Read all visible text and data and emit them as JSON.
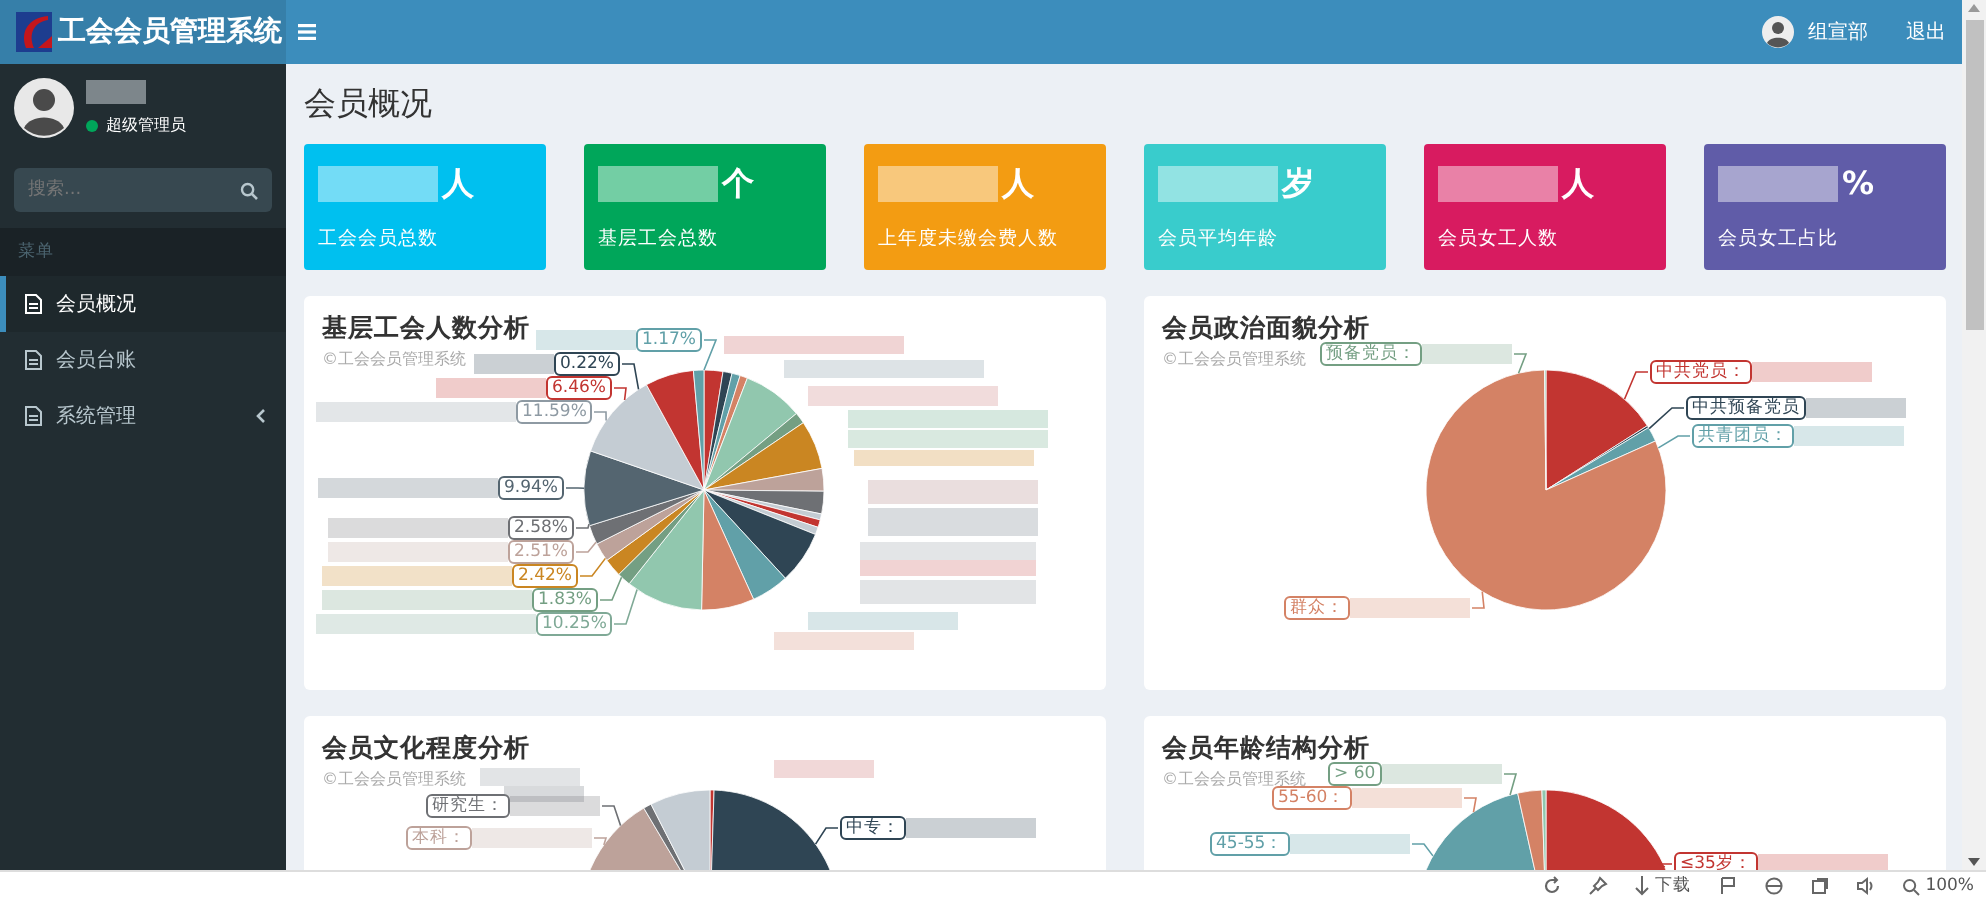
{
  "header": {
    "title": "工会会员管理系统",
    "user_name": "组宣部",
    "logout": "退出"
  },
  "sidebar": {
    "user_role": "超级管理员",
    "online": true,
    "search_placeholder": "搜索...",
    "menu_header": "菜单",
    "items": [
      {
        "label": "会员概况",
        "selected": true,
        "expandable": false
      },
      {
        "label": "会员台账",
        "selected": false,
        "expandable": false
      },
      {
        "label": "系统管理",
        "selected": false,
        "expandable": true
      }
    ]
  },
  "page_title": "会员概况",
  "stat_boxes": [
    {
      "unit": "人",
      "label": "工会会员总数",
      "color": "#00c0ef"
    },
    {
      "unit": "个",
      "label": "基层工会总数",
      "color": "#00a65a"
    },
    {
      "unit": "人",
      "label": "上年度未缴会费人数",
      "color": "#f39c12"
    },
    {
      "unit": "岁",
      "label": "会员平均年龄",
      "color": "#39cccc"
    },
    {
      "unit": "人",
      "label": "会员女工人数",
      "color": "#d81b60"
    },
    {
      "unit": "%",
      "label": "会员女工占比",
      "color": "#605ca8"
    }
  ],
  "charts": [
    {
      "title": "基层工会人数分析",
      "subtitle": "©工会会员管理系统",
      "labels": [
        {
          "text": "1.17%",
          "color": "#61a0a8"
        },
        {
          "text": "0.22%",
          "color": "#2f4554"
        },
        {
          "text": "6.46%",
          "color": "#c23531"
        },
        {
          "text": "11.59%",
          "color": "#8e9aa3"
        },
        {
          "text": "9.94%",
          "color": "#546570"
        },
        {
          "text": "2.58%",
          "color": "#6e7074"
        },
        {
          "text": "2.51%",
          "color": "#bda29a"
        },
        {
          "text": "2.42%",
          "color": "#ca8622"
        },
        {
          "text": "1.83%",
          "color": "#749f83"
        },
        {
          "text": "10.25%",
          "color": "#7fa996"
        }
      ]
    },
    {
      "title": "会员政治面貌分析",
      "subtitle": "©工会会员管理系统",
      "labels": [
        {
          "text": "预备党员：",
          "color": "#749f83"
        },
        {
          "text": "中共党员：",
          "color": "#c23531"
        },
        {
          "text": "中共预备党员",
          "color": "#2f4554"
        },
        {
          "text": "共青团员：",
          "color": "#61a0a8"
        },
        {
          "text": "群众：",
          "color": "#d48265"
        }
      ]
    },
    {
      "title": "会员文化程度分析",
      "subtitle": "©工会会员管理系统",
      "labels": [
        {
          "text": "研究生：",
          "color": "#6e7074"
        },
        {
          "text": "本科：",
          "color": "#bda29a"
        },
        {
          "text": "中专：",
          "color": "#2f4554"
        }
      ]
    },
    {
      "title": "会员年龄结构分析",
      "subtitle": "©工会会员管理系统",
      "labels": [
        {
          "text": "> 60",
          "color": "#749f83"
        },
        {
          "text": "55-60：",
          "color": "#d48265"
        },
        {
          "text": "45-55：",
          "color": "#61a0a8"
        },
        {
          "text": "≤35岁：",
          "color": "#c23531"
        }
      ]
    }
  ],
  "status_bar": {
    "download": "下载",
    "zoom": "100%"
  }
}
